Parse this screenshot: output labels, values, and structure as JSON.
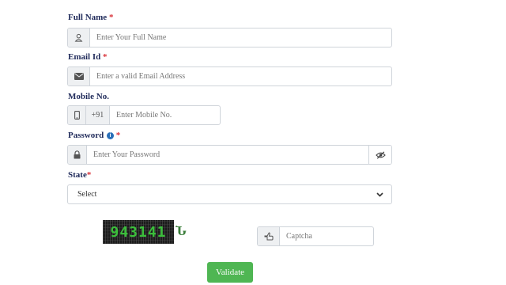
{
  "form": {
    "full_name": {
      "label": "Full Name",
      "required": "*",
      "placeholder": "Enter Your Full Name",
      "icon": "user-icon"
    },
    "email": {
      "label": "Email Id",
      "required": "*",
      "placeholder": "Enter a valid Email Address",
      "icon": "envelope-icon"
    },
    "mobile": {
      "label": "Mobile No.",
      "country_code": "+91",
      "placeholder": "Enter Mobile No.",
      "icon": "mobile-icon"
    },
    "password": {
      "label": "Password",
      "required": "*",
      "placeholder": "Enter Your Password",
      "icon": "lock-icon",
      "toggle_icon": "eye-slash-icon",
      "info_icon": "info-icon"
    },
    "state": {
      "label": "State",
      "required": "*",
      "selected": "Select"
    },
    "captcha": {
      "code": "943141",
      "refresh_glyph": "Ն",
      "placeholder": "Captcha",
      "icon": "hand-pointer-icon"
    },
    "submit_label": "Validate"
  },
  "colors": {
    "label": "#1f2a5a",
    "required": "#d9343b",
    "button": "#4fb653",
    "captcha_text": "#3bbf3b"
  }
}
